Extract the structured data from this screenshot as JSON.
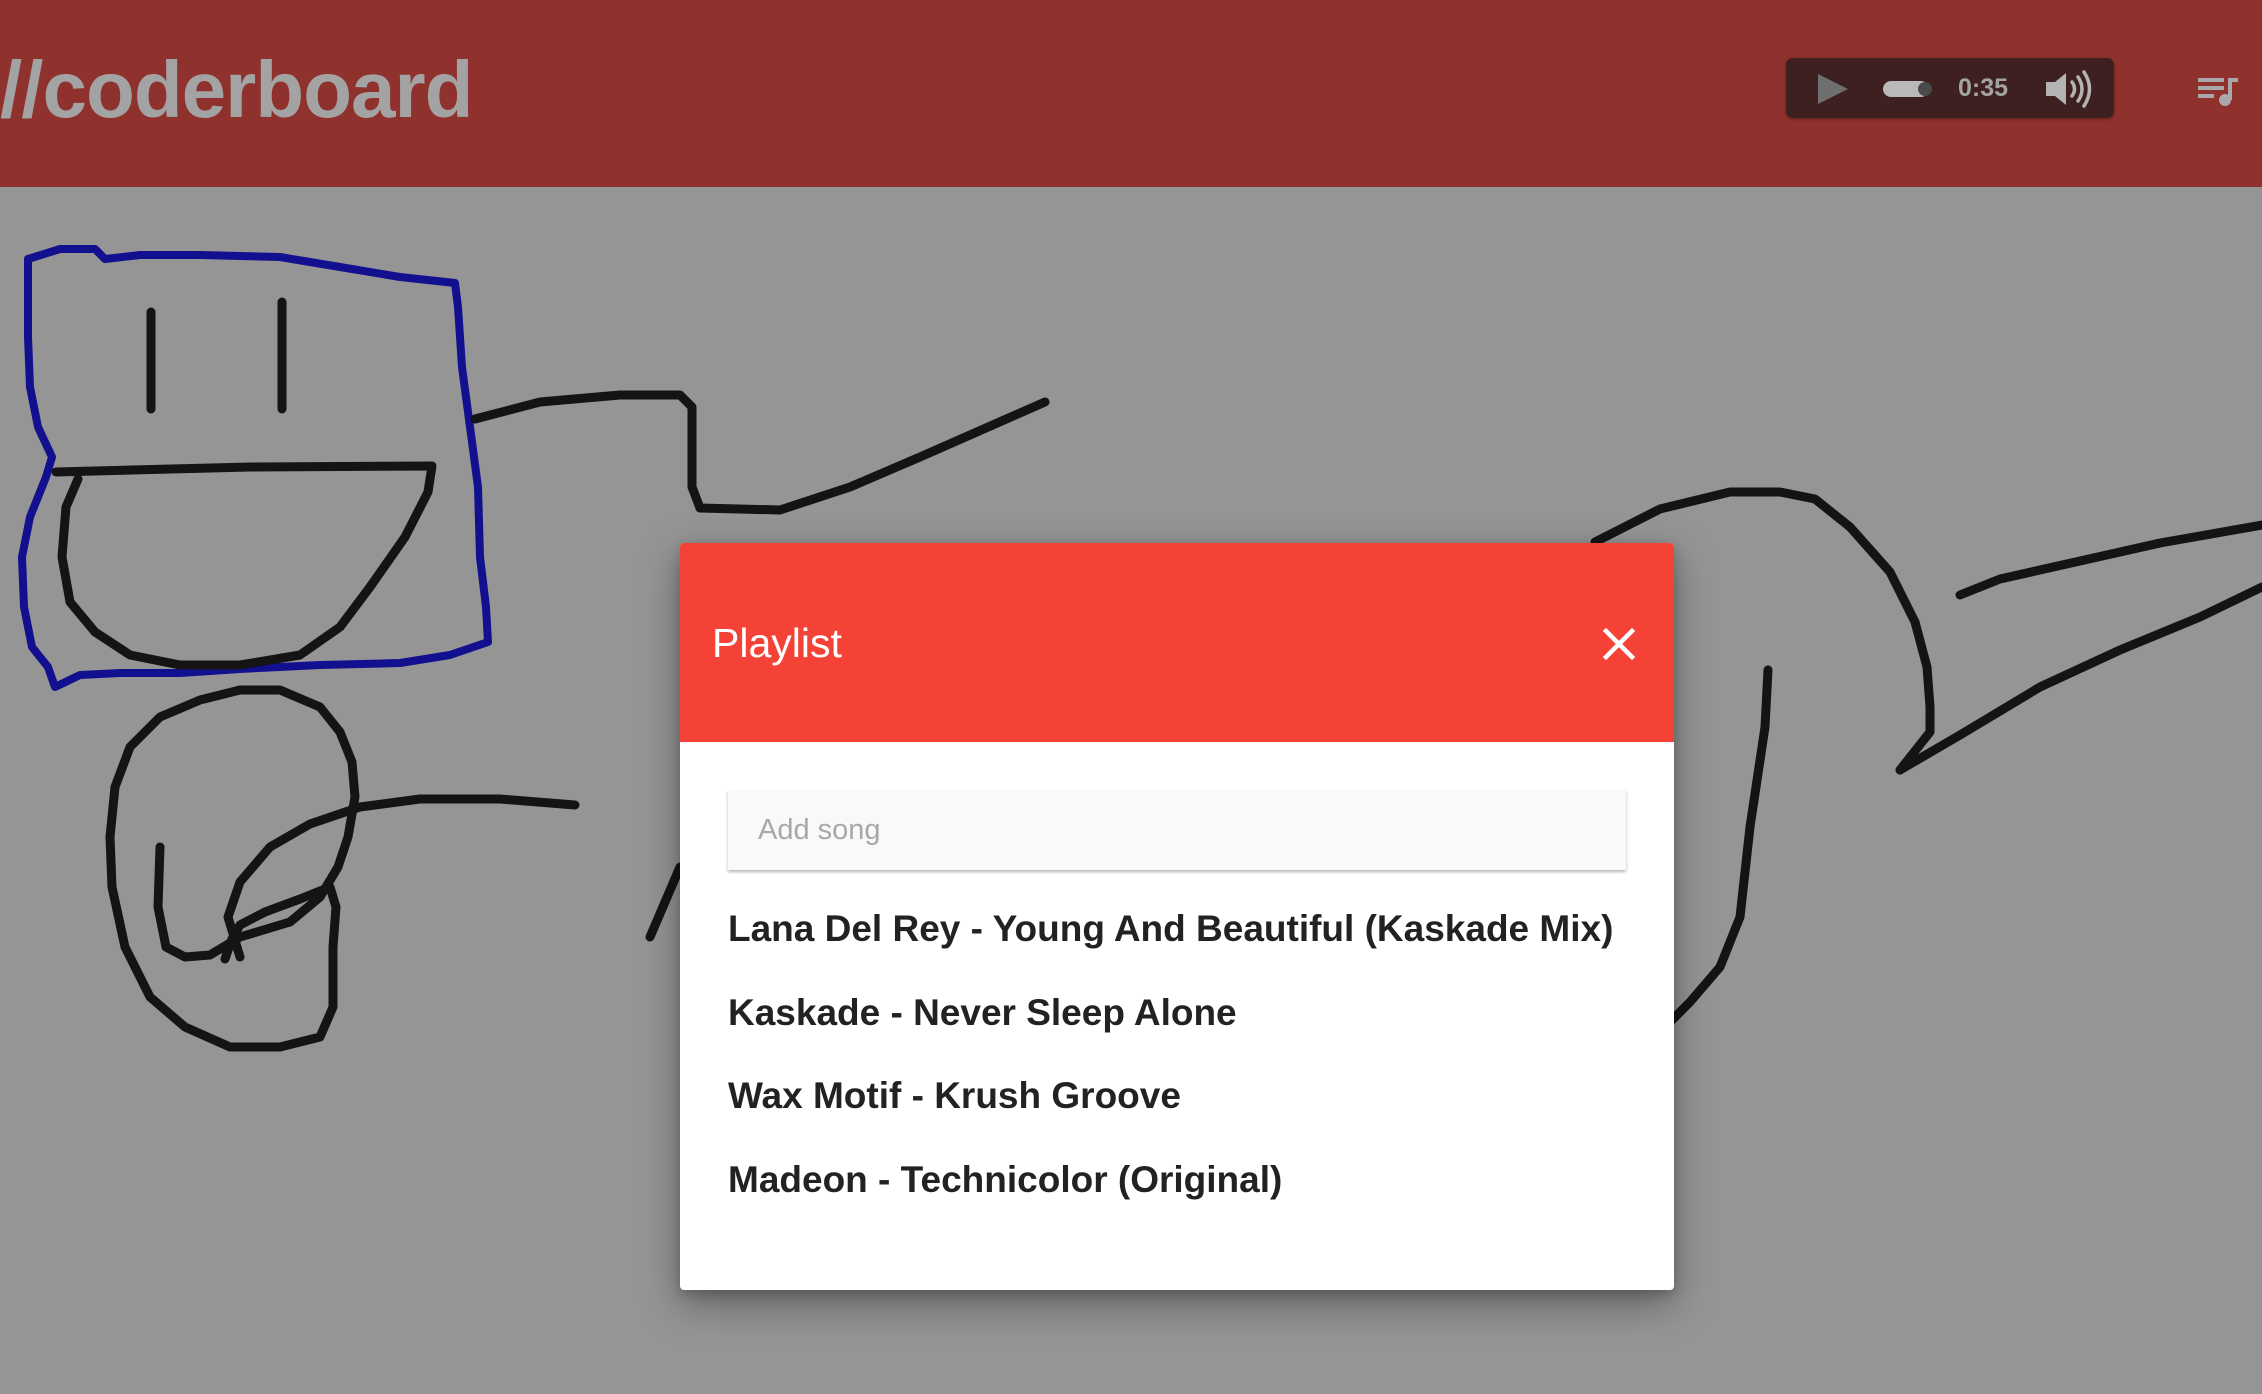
{
  "app": {
    "title": "//coderboard"
  },
  "player": {
    "play_icon": "play-icon",
    "time": "0:35",
    "volume_icon": "volume-icon",
    "playlist_icon": "playlist-icon"
  },
  "playlist_modal": {
    "title": "Playlist",
    "close_icon": "close-icon",
    "add_song": {
      "placeholder": "Add song",
      "value": ""
    },
    "songs": [
      "Lana Del Rey - Young And Beautiful (Kaskade Mix)",
      "Kaskade - Never Sleep Alone",
      "Wax Motif - Krush Groove",
      "Madeon - Technicolor (Original)"
    ]
  },
  "colors": {
    "header_bg": "#8f312d",
    "modal_header_bg": "#f44336",
    "canvas_bg": "#959595",
    "stroke_black": "#141414",
    "stroke_blue": "#12108f"
  }
}
